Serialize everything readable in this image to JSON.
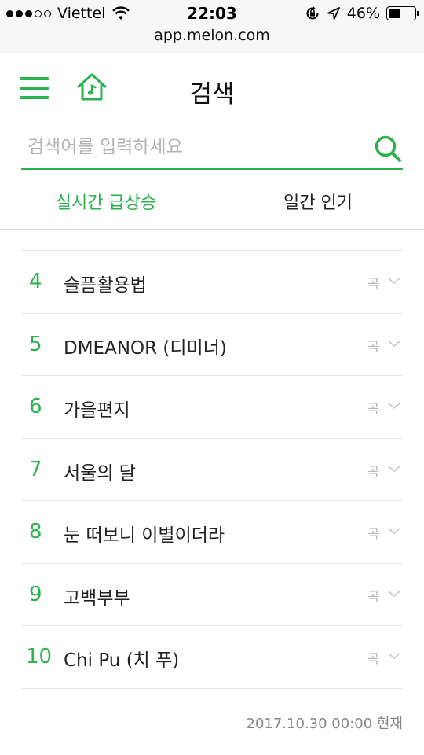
{
  "status_bar": {
    "carrier": "Viettel",
    "time": "22:03",
    "battery": "46%",
    "battery_level": 0.46
  },
  "browser": {
    "url": "app.melon.com"
  },
  "header": {
    "title": "검색",
    "menu_icon": "menu-icon",
    "home_icon": "home-music-icon"
  },
  "search": {
    "placeholder": "검색어를 입력하세요",
    "value": "",
    "icon": "search-icon"
  },
  "tabs": [
    {
      "label": "실시간 급상승",
      "active": true
    },
    {
      "label": "일간 인기",
      "active": false
    }
  ],
  "chart_list": [
    {
      "rank": "4",
      "title": "슬픔활용법",
      "kind": "곡"
    },
    {
      "rank": "5",
      "title": "DMEANOR (디미너)",
      "kind": "곡"
    },
    {
      "rank": "6",
      "title": "가을편지",
      "kind": "곡"
    },
    {
      "rank": "7",
      "title": "서울의 달",
      "kind": "곡"
    },
    {
      "rank": "8",
      "title": "눈 떠보니 이별이더라",
      "kind": "곡"
    },
    {
      "rank": "9",
      "title": "고백부부",
      "kind": "곡"
    },
    {
      "rank": "10",
      "title": "Chi Pu (치 푸)",
      "kind": "곡"
    }
  ],
  "footer": {
    "timestamp": "2017.10.30 00:00 현재"
  },
  "colors": {
    "accent": "#2bb24c",
    "muted": "#b5b5b5"
  }
}
